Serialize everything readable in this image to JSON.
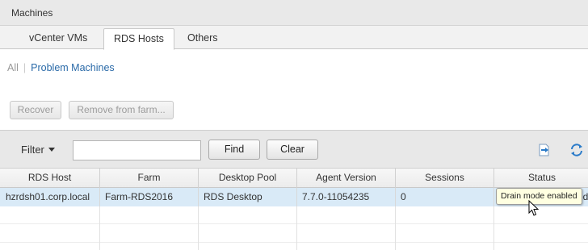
{
  "window": {
    "title": "Machines"
  },
  "tabs": [
    {
      "label": "vCenter VMs",
      "selected": false
    },
    {
      "label": "RDS Hosts",
      "selected": true
    },
    {
      "label": "Others",
      "selected": false
    }
  ],
  "views": {
    "all": "All",
    "problem": "Problem Machines"
  },
  "actions": {
    "recover": "Recover",
    "remove": "Remove from farm..."
  },
  "toolbar": {
    "filter_label": "Filter",
    "filter_value": "",
    "find_label": "Find",
    "clear_label": "Clear",
    "icons": {
      "export": "export-icon",
      "refresh": "refresh-icon"
    },
    "accent": "#2b7bc9"
  },
  "table": {
    "columns": [
      "RDS Host",
      "Farm",
      "Desktop Pool",
      "Agent Version",
      "Sessions",
      "Status"
    ],
    "rows": [
      {
        "host": "hzrdsh01.corp.local",
        "farm": "Farm-RDS2016",
        "pool": "RDS Desktop",
        "agent": "7.7.0-11054235",
        "sessions": "0",
        "status_tail": "ed"
      }
    ],
    "selected_row_color": "#d9eaf7"
  },
  "tooltip": {
    "text": "Drain mode enabled"
  }
}
